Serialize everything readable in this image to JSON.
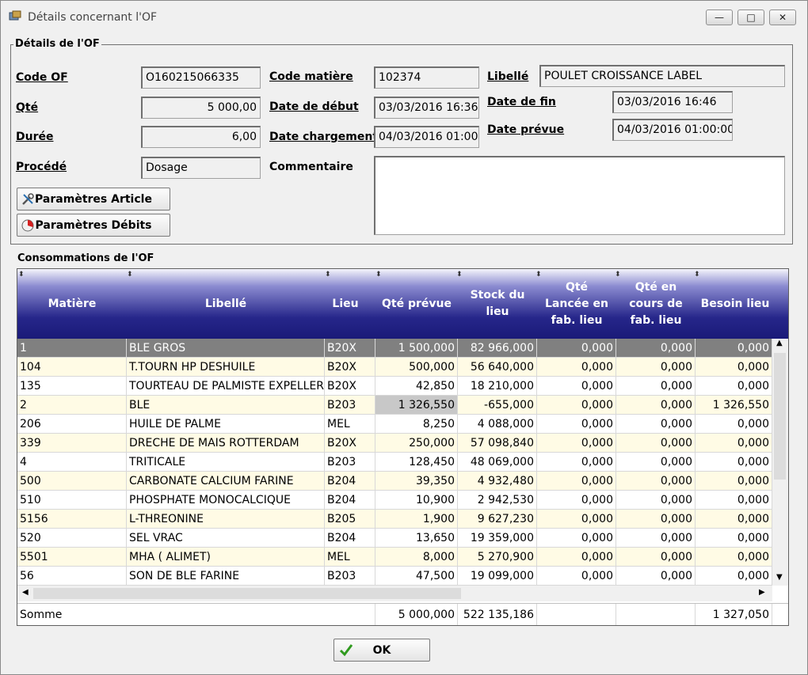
{
  "window": {
    "title": "Détails concernant l'OF",
    "minimize": "—",
    "maximize": "□",
    "close": "✕"
  },
  "details": {
    "legend": "Détails de l'OF",
    "code_of_label": "Code OF",
    "code_of_value": "O160215066335",
    "qte_label": "Qté",
    "qte_value": "5 000,00",
    "duree_label": "Durée",
    "duree_value": "6,00",
    "procede_label": "Procédé",
    "procede_value": "Dosage",
    "code_matiere_label": "Code matière",
    "code_matiere_value": "102374",
    "date_debut_label": "Date de début",
    "date_debut_value": "03/03/2016 16:36",
    "date_chargement_label": "Date chargement",
    "date_chargement_value": "04/03/2016 01:00",
    "commentaire_label": "Commentaire",
    "commentaire_value": "",
    "libelle_label": "Libellé",
    "libelle_value": "POULET CROISSANCE LABEL",
    "date_fin_label": "Date de fin",
    "date_fin_value": "03/03/2016 16:46",
    "date_prevue_label": "Date prévue",
    "date_prevue_value": "04/03/2016 01:00:00",
    "btn_param_article": "Paramètres Article",
    "btn_param_debits": "Paramètres Débits"
  },
  "consommations": {
    "legend": "Consommations de l'OF",
    "columns": [
      "Matière",
      "Libellé",
      "Lieu",
      "Qté prévue",
      "Stock du lieu",
      "Qté Lancée en fab. lieu",
      "Qté en cours de fab. lieu",
      "Besoin lieu"
    ],
    "rows": [
      [
        "1",
        "BLE GROS",
        "B20X",
        "1 500,000",
        "82 966,000",
        "0,000",
        "0,000",
        "0,000"
      ],
      [
        "104",
        "T.TOURN HP DESHUILE",
        "B20X",
        "500,000",
        "56 640,000",
        "0,000",
        "0,000",
        "0,000"
      ],
      [
        "135",
        "TOURTEAU DE PALMISTE EXPELLER",
        "B20X",
        "42,850",
        "18 210,000",
        "0,000",
        "0,000",
        "0,000"
      ],
      [
        "2",
        "BLE",
        "B203",
        "1 326,550",
        "-655,000",
        "0,000",
        "0,000",
        "1 326,550"
      ],
      [
        "206",
        "HUILE DE PALME",
        "MEL",
        "8,250",
        "4 088,000",
        "0,000",
        "0,000",
        "0,000"
      ],
      [
        "339",
        "DRECHE DE MAIS ROTTERDAM",
        "B20X",
        "250,000",
        "57 098,840",
        "0,000",
        "0,000",
        "0,000"
      ],
      [
        "4",
        "TRITICALE",
        "B203",
        "128,450",
        "48 069,000",
        "0,000",
        "0,000",
        "0,000"
      ],
      [
        "500",
        "CARBONATE CALCIUM FARINE",
        "B204",
        "39,350",
        "4 932,480",
        "0,000",
        "0,000",
        "0,000"
      ],
      [
        "510",
        "PHOSPHATE MONOCALCIQUE",
        "B204",
        "10,900",
        "2 942,530",
        "0,000",
        "0,000",
        "0,000"
      ],
      [
        "5156",
        "L-THREONINE",
        "B205",
        "1,900",
        "9 627,230",
        "0,000",
        "0,000",
        "0,000"
      ],
      [
        "520",
        "SEL VRAC",
        "B204",
        "13,650",
        "19 359,000",
        "0,000",
        "0,000",
        "0,000"
      ],
      [
        "5501",
        "MHA ( ALIMET)",
        "MEL",
        "8,000",
        "5 270,900",
        "0,000",
        "0,000",
        "0,000"
      ],
      [
        "56",
        "SON DE BLE FARINE",
        "B203",
        "47,500",
        "19 099,000",
        "0,000",
        "0,000",
        "0,000"
      ]
    ],
    "sum": {
      "label": "Somme",
      "qte_prevue": "5 000,000",
      "stock": "522 135,186",
      "besoin": "1 327,050"
    }
  },
  "ok_button": "OK",
  "colors": {
    "header_dark": "#1a1a78",
    "row_alt": "#fffbe5",
    "row_selected": "#808080",
    "cell_highlight": "#c8c8c8"
  }
}
